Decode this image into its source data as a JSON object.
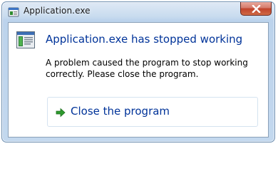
{
  "window": {
    "title": "Application.exe",
    "app_icon": "application-icon",
    "close_icon": "close-icon"
  },
  "dialog": {
    "icon": "program-window-icon",
    "heading": "Application.exe has stopped working",
    "message": "A problem caused the program to stop working correctly. Please close the program.",
    "command_link": {
      "icon": "green-arrow-icon",
      "label": "Close the program"
    }
  },
  "colors": {
    "heading": "#003399",
    "frame": "#c3d8ee",
    "close_button": "#c1432c",
    "arrow": "#2e9a2e"
  }
}
